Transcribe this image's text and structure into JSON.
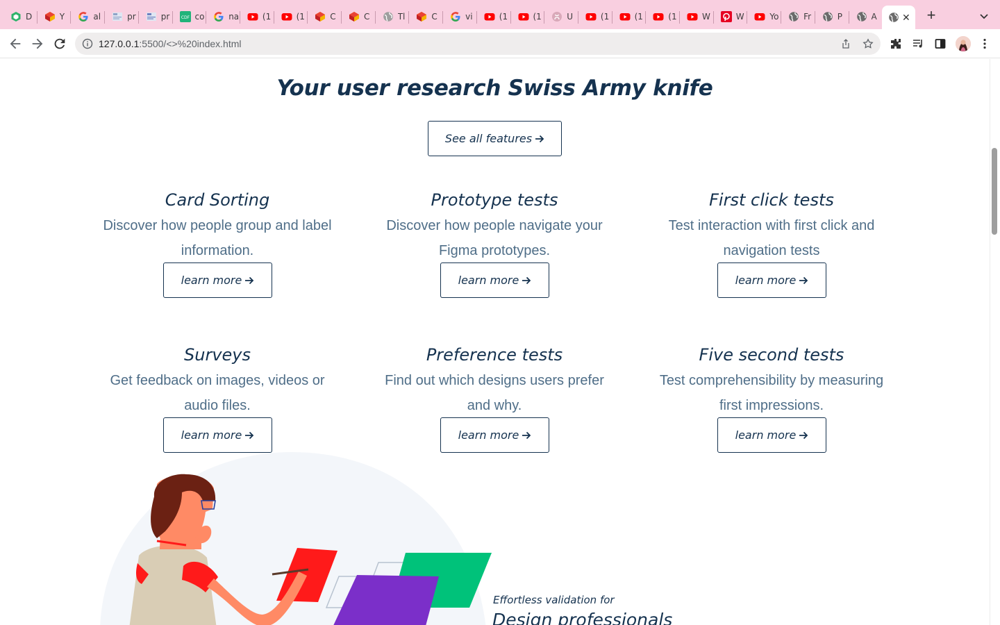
{
  "browser": {
    "tabs": [
      {
        "title": "D",
        "icon": "green-cube-icon",
        "color": "#2fb36b"
      },
      {
        "title": "Y",
        "icon": "multicolor-logo-icon",
        "color": "#f4b400"
      },
      {
        "title": "al",
        "icon": "google-g-icon",
        "color": "#4285f4"
      },
      {
        "title": "pr",
        "icon": "image-thumb-icon",
        "color": "#8fa3c7"
      },
      {
        "title": "pr",
        "icon": "image-thumb-icon",
        "color": "#6d7fbf"
      },
      {
        "title": "co",
        "icon": "cdf-icon",
        "color": "#21b37a"
      },
      {
        "title": "na",
        "icon": "google-g-icon",
        "color": "#4285f4"
      },
      {
        "title": "(1",
        "icon": "youtube-icon",
        "color": "#ff0000"
      },
      {
        "title": "(1",
        "icon": "youtube-icon",
        "color": "#ff0000"
      },
      {
        "title": "C",
        "icon": "multicolor-logo-icon",
        "color": "#f4b400"
      },
      {
        "title": "C",
        "icon": "multicolor-logo-icon",
        "color": "#f4b400"
      },
      {
        "title": "Tl",
        "icon": "globe-icon",
        "color": "#9e9e9e"
      },
      {
        "title": "C",
        "icon": "multicolor-logo-icon",
        "color": "#f4b400"
      },
      {
        "title": "vi",
        "icon": "google-g-icon",
        "color": "#4285f4"
      },
      {
        "title": "(1",
        "icon": "youtube-icon",
        "color": "#ff0000"
      },
      {
        "title": "(1",
        "icon": "youtube-icon",
        "color": "#ff0000"
      },
      {
        "title": "U",
        "icon": "github-icon",
        "color": "#d9a9b9"
      },
      {
        "title": "(1",
        "icon": "youtube-icon",
        "color": "#ff0000"
      },
      {
        "title": "(1",
        "icon": "youtube-icon",
        "color": "#ff0000"
      },
      {
        "title": "(1",
        "icon": "youtube-icon",
        "color": "#ff0000"
      },
      {
        "title": "W",
        "icon": "youtube-icon",
        "color": "#ff0000"
      },
      {
        "title": "W",
        "icon": "pinterest-like-icon",
        "color": "#e60023"
      },
      {
        "title": "Yo",
        "icon": "youtube-icon",
        "color": "#ff0000"
      },
      {
        "title": "Fr",
        "icon": "globe-icon",
        "color": "#6b6b6b"
      },
      {
        "title": "P",
        "icon": "globe-icon",
        "color": "#6b6b6b"
      },
      {
        "title": "A",
        "icon": "globe-icon",
        "color": "#6b6b6b"
      }
    ],
    "active_tab_icon": "globe-icon",
    "address": {
      "host": "127.0.0.1",
      "path": ":5500/<>%20index.html"
    }
  },
  "page": {
    "headline": "Your user research Swiss Army knife",
    "see_all_label": "See all features",
    "features": [
      {
        "title": "Card Sorting",
        "desc": "Discover how people group and label information.",
        "button": "learn more"
      },
      {
        "title": "Prototype tests",
        "desc": "Discover how people navigate your Figma prototypes.",
        "button": "learn more"
      },
      {
        "title": "First click tests",
        "desc": "Test interaction with first click and navigation tests",
        "button": "learn more"
      },
      {
        "title": "Surveys",
        "desc": "Get feedback on images, videos or audio files.",
        "button": "learn more"
      },
      {
        "title": "Preference tests",
        "desc": "Find out which designs users prefer and why.",
        "button": "learn more"
      },
      {
        "title": "Five second tests",
        "desc": "Test comprehensibility by measuring first impressions.",
        "button": "learn more"
      }
    ],
    "promo": {
      "kicker": "Effortless validation for",
      "heading": "Design professionals"
    }
  },
  "colors": {
    "tabstrip": "#f9cfe0",
    "navy": "#15324f",
    "body_text": "#4f6e88",
    "card_red": "#ff1a1a",
    "card_green": "#00c27a",
    "card_purple": "#7b2fc9"
  }
}
